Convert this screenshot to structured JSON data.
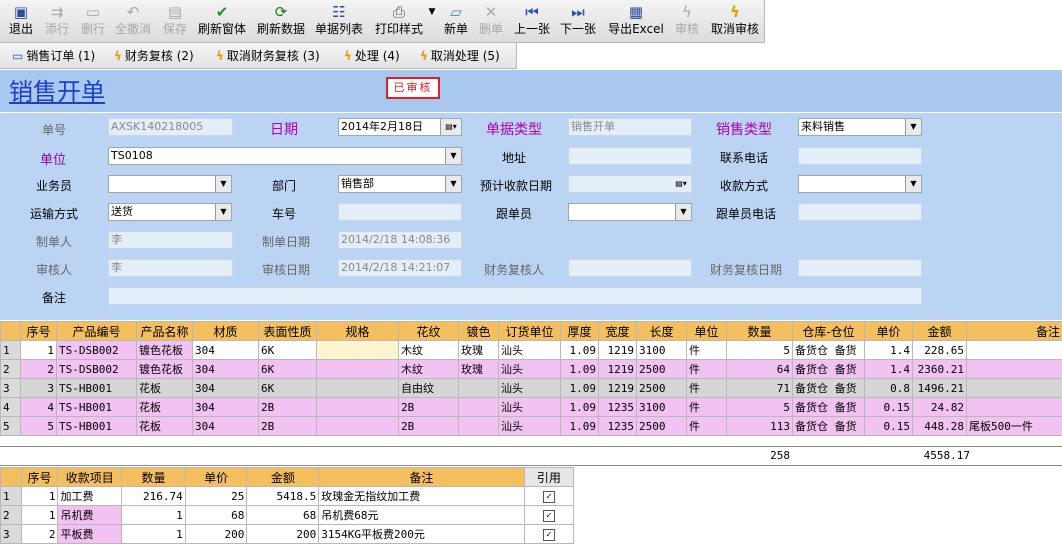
{
  "toolbar": {
    "exit": "退出",
    "add_row": "添行",
    "delete_row": "删行",
    "cancel_all": "全撤消",
    "save": "保存",
    "refresh_window": "刷新窗体",
    "refresh_data": "刷新数据",
    "doc_list": "单据列表",
    "print_style": "打印样式",
    "new_doc": "新单",
    "delete_doc": "删单",
    "prev": "上一张",
    "next": "下一张",
    "export_excel": "导出Excel",
    "approve": "审核",
    "cancel_approve": "取消审核"
  },
  "tabs": [
    {
      "label": "销售订单 (1)"
    },
    {
      "label": "财务复核 (2)"
    },
    {
      "label": "取消财务复核 (3)"
    },
    {
      "label": "处理 (4)"
    },
    {
      "label": "取消处理 (5)"
    }
  ],
  "header": {
    "title": "销售开单",
    "status": "已审核"
  },
  "form": {
    "doc_no_label": "单号",
    "doc_no": "AXSK140218005",
    "date_label": "日期",
    "date": "2014年2月18日",
    "doc_type_label": "单据类型",
    "doc_type": "销售开单",
    "sales_type_label": "销售类型",
    "sales_type": "来料销售",
    "unit_label": "单位",
    "unit": "TS0108",
    "address_label": "地址",
    "address": "",
    "phone_label": "联系电话",
    "phone": "",
    "salesman_label": "业务员",
    "salesman": "",
    "dept_label": "部门",
    "dept": "销售部",
    "expected_date_label": "预计收款日期",
    "expected_date": "",
    "payment_method_label": "收款方式",
    "payment_method": "",
    "transport_label": "运输方式",
    "transport": "送货",
    "car_no_label": "车号",
    "car_no": "",
    "follower_label": "跟单员",
    "follower": "",
    "follower_phone_label": "跟单员电话",
    "follower_phone": "",
    "creator_label": "制单人",
    "creator": "李",
    "create_date_label": "制单日期",
    "create_date": "2014/2/18 14:08:36",
    "approver_label": "审核人",
    "approver": "李",
    "approve_date_label": "审核日期",
    "approve_date": "2014/2/18 14:21:07",
    "fin_reviewer_label": "财务复核人",
    "fin_reviewer": "",
    "fin_review_date_label": "财务复核日期",
    "fin_review_date": "",
    "remark_label": "备注",
    "remark": ""
  },
  "items_table": {
    "headers": [
      "序号",
      "产品编号",
      "产品名称",
      "材质",
      "表面性质",
      "规格",
      "花纹",
      "镀色",
      "订货单位",
      "厚度",
      "宽度",
      "长度",
      "单位",
      "数量",
      "仓库-仓位",
      "单价",
      "金额",
      "备注"
    ],
    "rows": [
      [
        "1",
        "TS-DSB002",
        "镀色花板",
        "304",
        "6K",
        "",
        "木纹",
        "玫瑰",
        "汕头",
        "1.09",
        "1219",
        "3100",
        "件",
        "5",
        "备货仓 备货",
        "1.4",
        "228.65",
        ""
      ],
      [
        "2",
        "TS-DSB002",
        "镀色花板",
        "304",
        "6K",
        "",
        "木纹",
        "玫瑰",
        "汕头",
        "1.09",
        "1219",
        "2500",
        "件",
        "64",
        "备货仓 备货",
        "1.4",
        "2360.21",
        ""
      ],
      [
        "3",
        "TS-HB001",
        "花板",
        "304",
        "6K",
        "",
        "自由纹",
        "",
        "汕头",
        "1.09",
        "1219",
        "2500",
        "件",
        "71",
        "备货仓 备货",
        "0.8",
        "1496.21",
        ""
      ],
      [
        "4",
        "TS-HB001",
        "花板",
        "304",
        "2B",
        "",
        "2B",
        "",
        "汕头",
        "1.09",
        "1235",
        "3100",
        "件",
        "5",
        "备货仓 备货",
        "0.15",
        "24.82",
        ""
      ],
      [
        "5",
        "TS-HB001",
        "花板",
        "304",
        "2B",
        "",
        "2B",
        "",
        "汕头",
        "1.09",
        "1235",
        "2500",
        "件",
        "113",
        "备货仓 备货",
        "0.15",
        "448.28",
        "尾板500一件"
      ]
    ],
    "total_qty": "258",
    "total_amount": "4558.17"
  },
  "fees_table": {
    "headers": [
      "序号",
      "收款项目",
      "数量",
      "单价",
      "金额",
      "备注",
      "引用"
    ],
    "rows": [
      [
        "1",
        "加工费",
        "216.74",
        "25",
        "5418.5",
        "玫瑰金无指纹加工费"
      ],
      [
        "1",
        "吊机费",
        "1",
        "68",
        "68",
        "吊机费68元"
      ],
      [
        "2",
        "平板费",
        "1",
        "200",
        "200",
        "3154KG平板费200元"
      ]
    ]
  }
}
